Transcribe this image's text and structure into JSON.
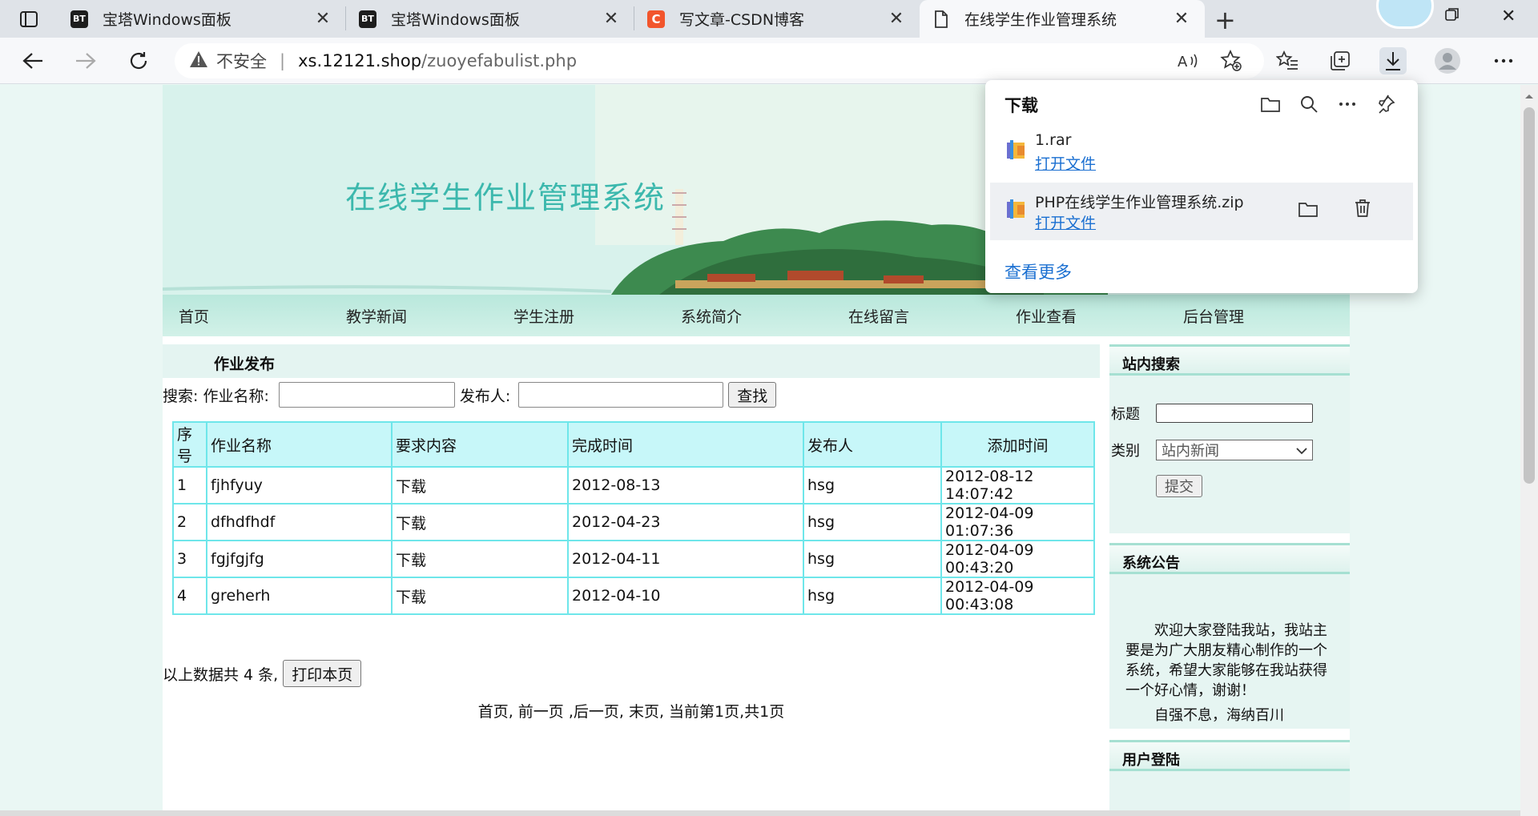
{
  "browser": {
    "tabs": [
      {
        "title": "宝塔Windows面板",
        "favicon": "BT"
      },
      {
        "title": "宝塔Windows面板",
        "favicon": "BT"
      },
      {
        "title": "写文章-CSDN博客",
        "favicon": "C"
      },
      {
        "title": "在线学生作业管理系统",
        "favicon": "page-icon"
      }
    ],
    "address": {
      "security_label": "不安全",
      "host": "xs.12121.shop",
      "path": "/zuoyefabulist.php"
    }
  },
  "downloads": {
    "title": "下载",
    "items": [
      {
        "name": "1.rar",
        "action": "打开文件"
      },
      {
        "name": "PHP在线学生作业管理系统.zip",
        "action": "打开文件"
      }
    ],
    "more": "查看更多"
  },
  "site": {
    "title": "在线学生作业管理系统",
    "nav": [
      "首页",
      "教学新闻",
      "学生注册",
      "系统简介",
      "在线留言",
      "作业查看",
      "后台管理"
    ],
    "section_title": "作业发布",
    "search": {
      "label_name": "搜索: 作业名称:",
      "label_publisher": "发布人:",
      "button": "查找"
    },
    "table": {
      "headers": [
        "序号",
        "作业名称",
        "要求内容",
        "完成时间",
        "发布人",
        "添加时间"
      ],
      "rows": [
        [
          "1",
          "fjhfyuy",
          "下载",
          "2012-08-13",
          "hsg",
          "2012-08-12 14:07:42"
        ],
        [
          "2",
          "dfhdfhdf",
          "下载",
          "2012-04-23",
          "hsg",
          "2012-04-09 01:07:36"
        ],
        [
          "3",
          "fgjfgjfg",
          "下载",
          "2012-04-11",
          "hsg",
          "2012-04-09 00:43:20"
        ],
        [
          "4",
          "greherh",
          "下载",
          "2012-04-10",
          "hsg",
          "2012-04-09 00:43:08"
        ]
      ]
    },
    "count_text": "以上数据共 4 条,",
    "print_button": "打印本页",
    "pager": "首页, 前一页 ,后一页, 末页, 当前第1页,共1页",
    "sidebar": {
      "search_title": "站内搜索",
      "label_title": "标题",
      "label_category": "类别",
      "category_value": "站内新闻",
      "submit": "提交",
      "notice_title": "系统公告",
      "notice_text": "欢迎大家登陆我站，我站主要是为广大朋友精心制作的一个系统，希望大家能够在我站获得一个好心情，谢谢！",
      "notice_cut": "自强不息，海纳百川",
      "login_title": "用户登陆"
    }
  }
}
